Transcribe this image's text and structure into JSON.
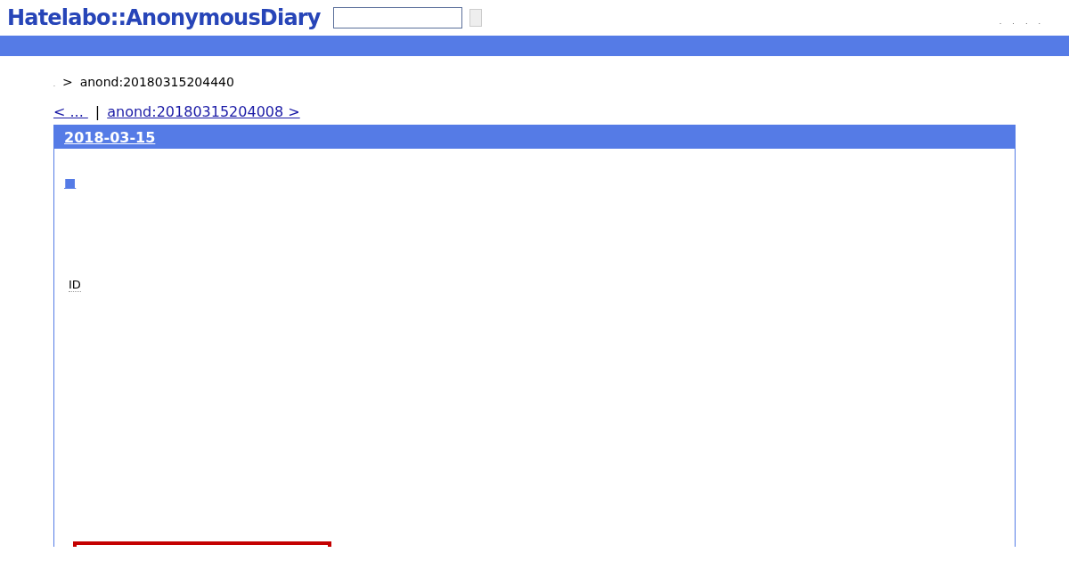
{
  "header": {
    "logo": "Hatelabo::AnonymousDiary",
    "menu_links": [
      ".",
      ".",
      ".",
      "."
    ]
  },
  "breadcrumb": {
    "home": ".",
    "separator": ">",
    "current": "anond:20180315204440"
  },
  "pager": {
    "prev": "< ... ",
    "divider": "|",
    "next": "anond:20180315204008 >"
  },
  "entry": {
    "date": "2018-03-15",
    "section_mark": "■",
    "id_label": "ID"
  }
}
